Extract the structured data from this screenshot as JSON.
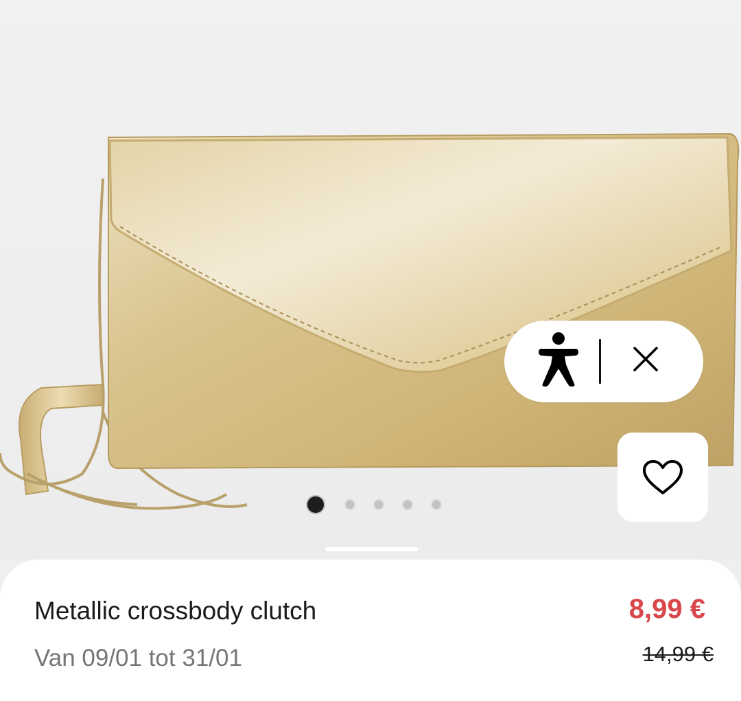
{
  "product": {
    "title": "Metallic crossbody clutch",
    "availability": "Van 09/01 tot 31/01",
    "price_current": "8,99 €",
    "price_original": "14,99 €"
  },
  "gallery": {
    "image_count": 5,
    "active_index": 1
  },
  "icons": {
    "accessibility": "accessibility-person-icon",
    "close": "close-icon",
    "favorite": "heart-outline-icon"
  },
  "colors": {
    "price_sale": "#d9474a",
    "text_primary": "#1b1b1b",
    "text_secondary": "#757575",
    "background": "#efefef"
  }
}
